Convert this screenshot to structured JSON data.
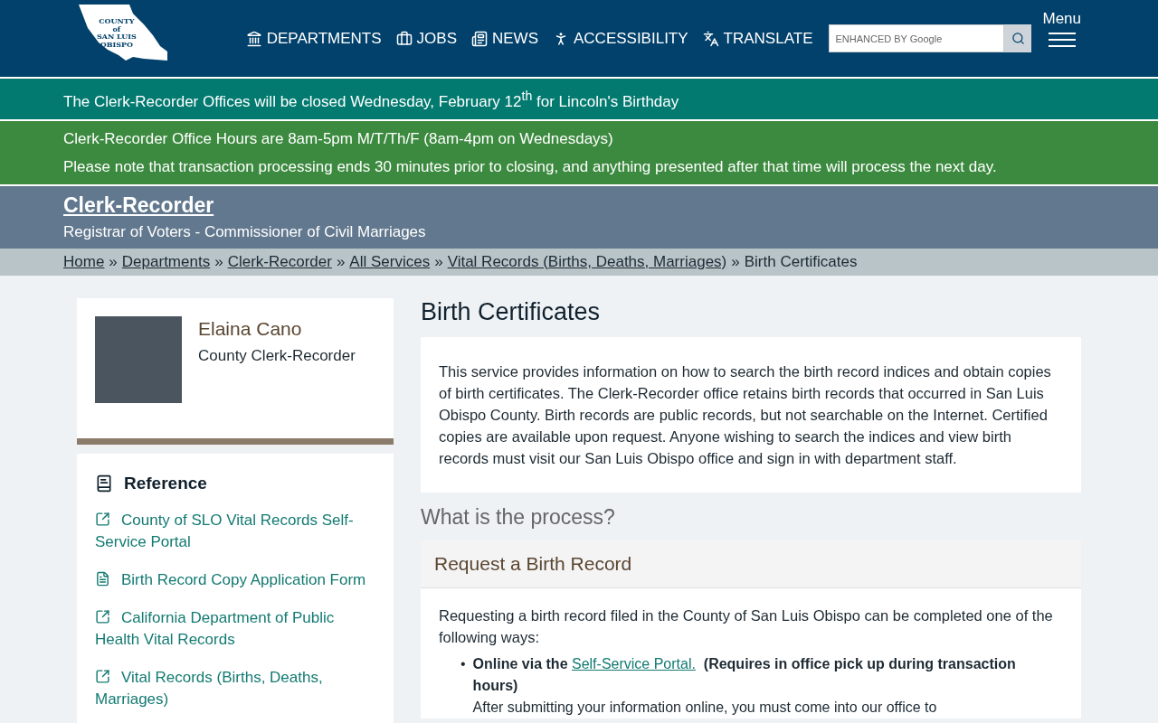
{
  "header": {
    "logo": {
      "lines": [
        "COUNTY",
        "SAN LUIS",
        "OBISPO"
      ],
      "small": "of"
    },
    "nav": [
      {
        "label": "DEPARTMENTS"
      },
      {
        "label": "JOBS"
      },
      {
        "label": "NEWS"
      },
      {
        "label": "ACCESSIBILITY"
      },
      {
        "label": "TRANSLATE"
      }
    ],
    "search": {
      "placeholder": "ENHANCED BY Google"
    },
    "menu": {
      "label": "Menu"
    }
  },
  "alerts": [
    {
      "kind": "closure",
      "lines": [
        "The Clerk-Recorder Offices will be closed Wednesday, February 12$^{th}$ for Lincoln's Birthday"
      ]
    },
    {
      "kind": "hours",
      "lines": [
        "Clerk-Recorder Office Hours are 8am-5pm M/T/Th/F (8am-4pm on Wednesdays)",
        "Please note that transaction processing ends 30 minutes prior to closing, and anything presented after that time will process the next day."
      ]
    }
  ],
  "banner": {
    "title": "Clerk-Recorder",
    "subtitle": "Registrar of Voters - Commissioner of Civil Marriages"
  },
  "breadcrumb": [
    {
      "label": "Home",
      "link": true,
      "separator": "»"
    },
    {
      "label": "Departments",
      "link": true,
      "separator": "»"
    },
    {
      "label": "Clerk-Recorder",
      "link": true,
      "separator": "»"
    },
    {
      "label": "All Services",
      "link": true,
      "separator": "»"
    },
    {
      "label": "Vital Records (Births, Deaths, Marriages)",
      "link": true,
      "separator": "»"
    },
    {
      "label": "Birth Certificates",
      "link": false
    }
  ],
  "profile": {
    "name": "Elaina Cano",
    "title": "County Clerk-Recorder"
  },
  "reference": {
    "heading": "Reference",
    "links": [
      {
        "label": "County of SLO Vital Records Self-Service Portal",
        "kind": "external"
      },
      {
        "label": "Birth Record Copy Application Form",
        "kind": "document"
      },
      {
        "label": "California Department of Public Health Vital Records",
        "kind": "external"
      },
      {
        "label": "Vital Records (Births, Deaths, Marriages)",
        "kind": "external"
      }
    ]
  },
  "main": {
    "title": "Birth Certificates",
    "intro": "This service provides information on how to search the birth record indices and obtain copies of birth certificates. The Clerk-Recorder office retains birth records that occurred in San Luis Obispo County. Birth records are public records, but not searchable on the Internet. Certified copies are available upon request. Anyone wishing to search the indices and view birth records must visit our San Luis Obispo office and sign in with department staff.",
    "section_heading": "What is the process?",
    "panel": {
      "title": "Request a Birth Record",
      "text": "Requesting a birth record filed in the County of San Luis Obispo can be completed one of the following ways:",
      "items": [
        {
          "bullet": "•",
          "lead": "Online via the",
          "link": "Self-Service Portal.",
          "note": "(Requires in office pick up during transaction hours)",
          "detail": "After submitting your information online, you must come into our office to"
        }
      ]
    }
  }
}
